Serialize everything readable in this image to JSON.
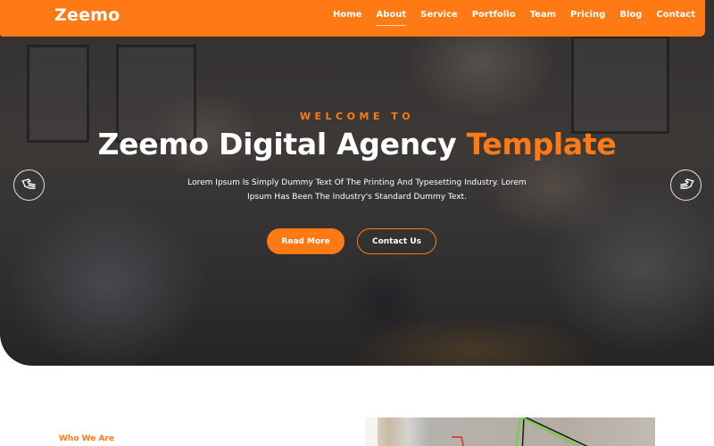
{
  "navbar": {
    "logo": "Zeemo",
    "brand_color": "#ff7a14",
    "links": [
      {
        "label": "Home",
        "active": false
      },
      {
        "label": "About",
        "active": true
      },
      {
        "label": "Service",
        "active": false
      },
      {
        "label": "Portfolio",
        "active": false
      },
      {
        "label": "Team",
        "active": false
      },
      {
        "label": "Pricing",
        "active": false
      },
      {
        "label": "Blog",
        "active": false
      },
      {
        "label": "Contact",
        "active": false
      }
    ]
  },
  "hero": {
    "eyebrow": "WELCOME TO",
    "title_main": "Zeemo Digital Agency ",
    "title_accent": "Template",
    "description": "Lorem Ipsum Is Simply Dummy Text Of The Printing And Typesetting Industry. Lorem Ipsum Has Been The Industry's Standard Dummy Text.",
    "primary_button": "Read More",
    "secondary_button": "Contact Us",
    "prev_icon": "hand-pointing-left-icon",
    "next_icon": "hand-pointing-right-icon"
  },
  "about": {
    "label": "Who We Are"
  }
}
